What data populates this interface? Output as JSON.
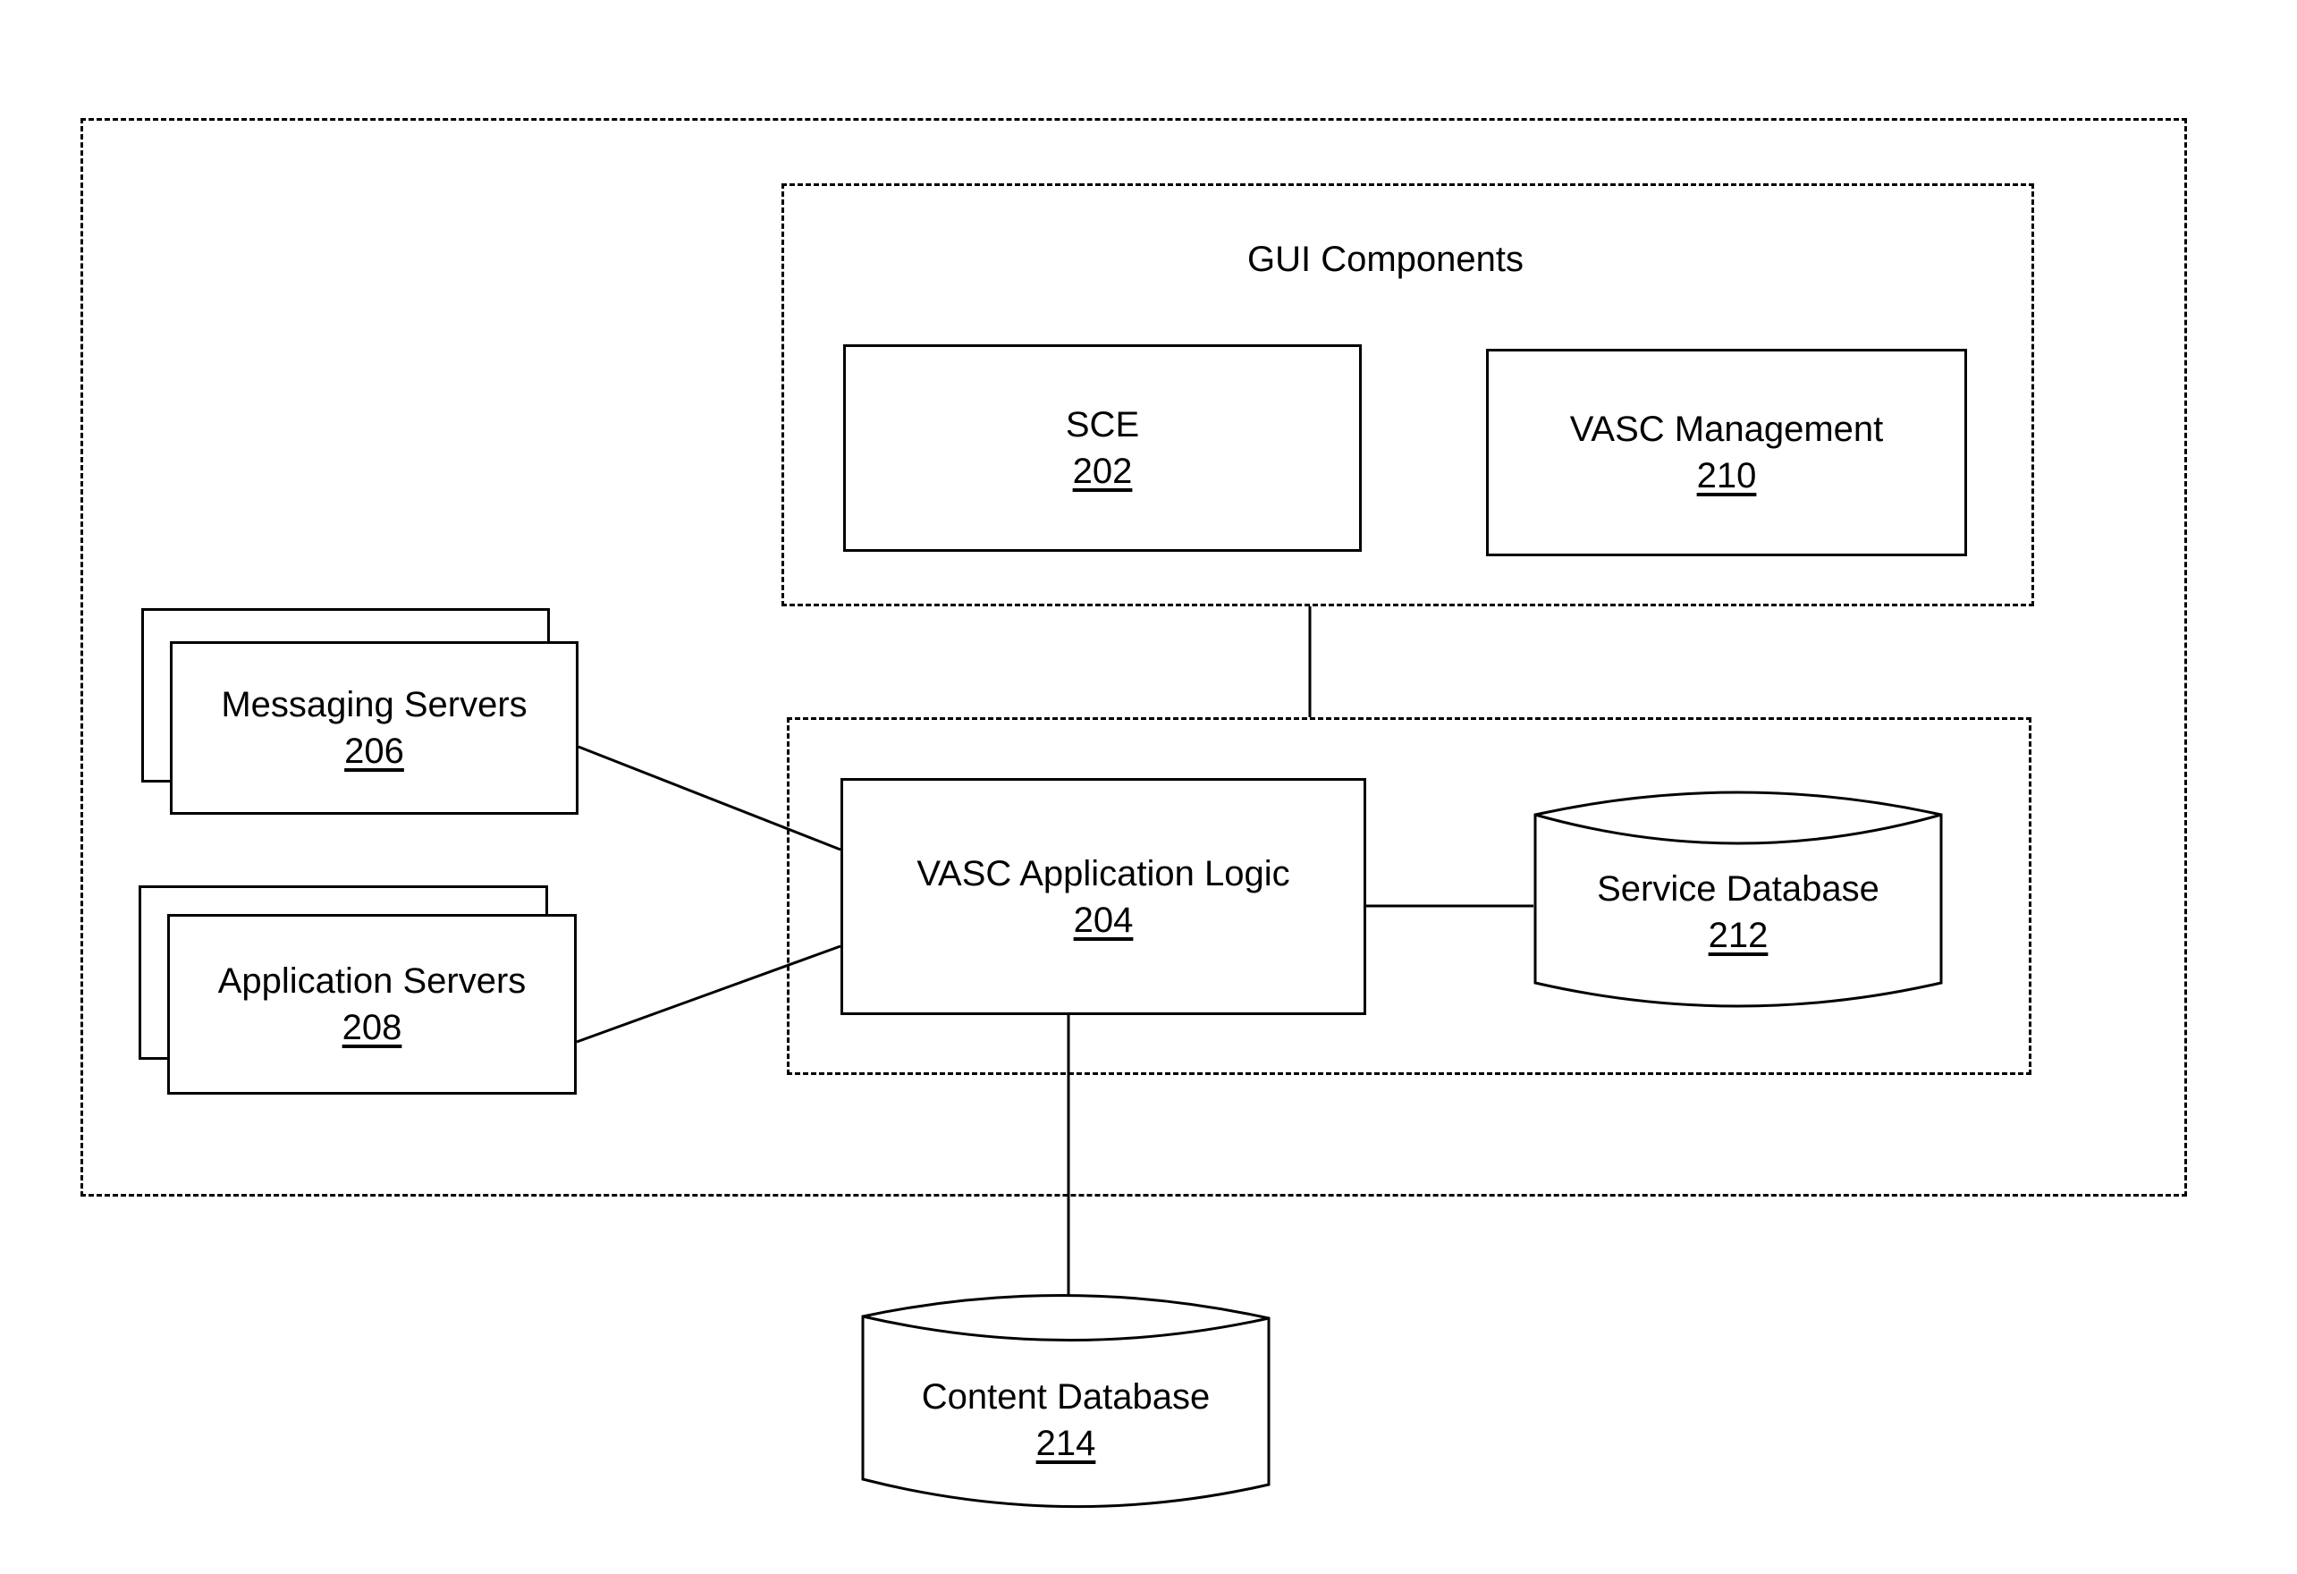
{
  "diagram": {
    "system_boundary": {
      "label": ""
    },
    "gui_components": {
      "title": "GUI Components",
      "sce": {
        "label": "SCE",
        "ref": "202"
      },
      "vasc_management": {
        "label": "VASC Management",
        "ref": "210"
      }
    },
    "logic_group": {
      "vasc_application_logic": {
        "label": "VASC Application Logic",
        "ref": "204"
      },
      "service_database": {
        "label": "Service Database",
        "ref": "212"
      }
    },
    "messaging_servers": {
      "label": "Messaging Servers",
      "ref": "206"
    },
    "application_servers": {
      "label": "Application Servers",
      "ref": "208"
    },
    "content_database": {
      "label": "Content Database",
      "ref": "214"
    },
    "connections": [
      {
        "from": "GUI Components",
        "to": "VASC Application Logic group"
      },
      {
        "from": "Messaging Servers",
        "to": "VASC Application Logic"
      },
      {
        "from": "Application Servers",
        "to": "VASC Application Logic"
      },
      {
        "from": "VASC Application Logic",
        "to": "Service Database"
      },
      {
        "from": "VASC Application Logic",
        "to": "Content Database"
      }
    ]
  }
}
